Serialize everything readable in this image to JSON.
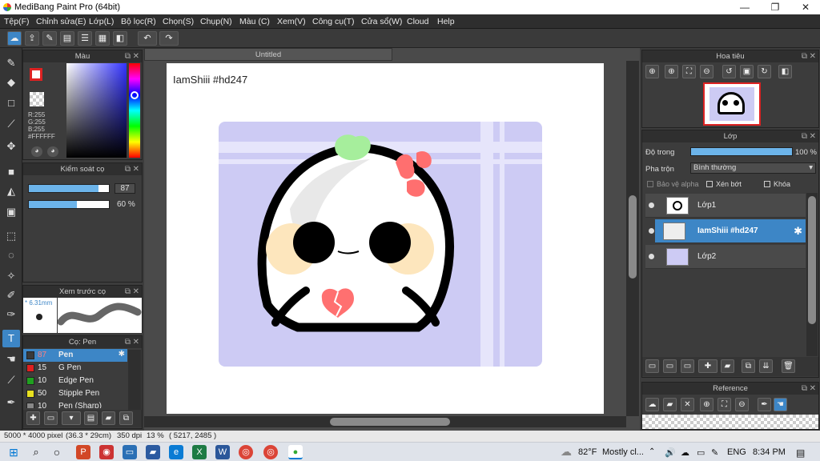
{
  "window": {
    "title": "MediBang Paint Pro (64bit)",
    "minimize": "—",
    "restore": "❐",
    "close": "✕"
  },
  "menu": [
    "Tệp(F)",
    "Chỉnh sửa(E)",
    "Lớp(L)",
    "Bộ lọc(R)",
    "Chọn(S)",
    "Chụp(N)",
    "Màu (C)",
    "Xem(V)",
    "Công cụ(T)",
    "Cửa sổ(W)",
    "Cloud",
    "Help"
  ],
  "color_panel": {
    "title": "Màu",
    "r": "R:255",
    "g": "G:255",
    "b": "B:255",
    "hex": "#FFFFFF"
  },
  "brush_control": {
    "title": "Kiểm soát cọ",
    "size": 87,
    "opacity": "60 %",
    "opacity_value": 60
  },
  "brush_preview": {
    "title": "Xem trước cọ",
    "size_label": "* 6.31mm"
  },
  "brushes": {
    "title": "Cọ: Pen",
    "items": [
      {
        "size": "87",
        "name": "Pen",
        "color": "#3a3a3a"
      },
      {
        "size": "15",
        "name": "G Pen",
        "color": "#e02020"
      },
      {
        "size": "10",
        "name": "Edge Pen",
        "color": "#20a020"
      },
      {
        "size": "50",
        "name": "Stipple Pen",
        "color": "#e8e020"
      },
      {
        "size": "10",
        "name": "Pen (Sharp)",
        "color": "#888888"
      }
    ]
  },
  "canvas": {
    "tab": "Untitled",
    "signature": "IamShiii #hd247"
  },
  "navigator": {
    "title": "Hoa tiêu"
  },
  "layers": {
    "title": "Lớp",
    "opacity_label": "Độ trong",
    "opacity": "100 %",
    "opacity_value": 100,
    "blend_label": "Pha trộn",
    "blend_mode": "Bình thường",
    "protect_alpha": "Bảo vệ alpha",
    "clipping": "Xén bớt",
    "lock": "Khóa",
    "items": [
      {
        "name": "Lớp1"
      },
      {
        "name": "IamShiii #hd247"
      },
      {
        "name": "Lớp2"
      }
    ]
  },
  "reference": {
    "title": "Reference"
  },
  "status": {
    "size": "5000 * 4000 pixel",
    "cm": "(36.3 * 29cm)",
    "dpi": "350 dpi",
    "zoom": "13 %",
    "coords": "( 5217, 2485 )"
  },
  "taskbar": {
    "weather_temp": "82°F",
    "weather_text": "Mostly cl...",
    "lang": "ENG",
    "time": "8:34 PM"
  }
}
